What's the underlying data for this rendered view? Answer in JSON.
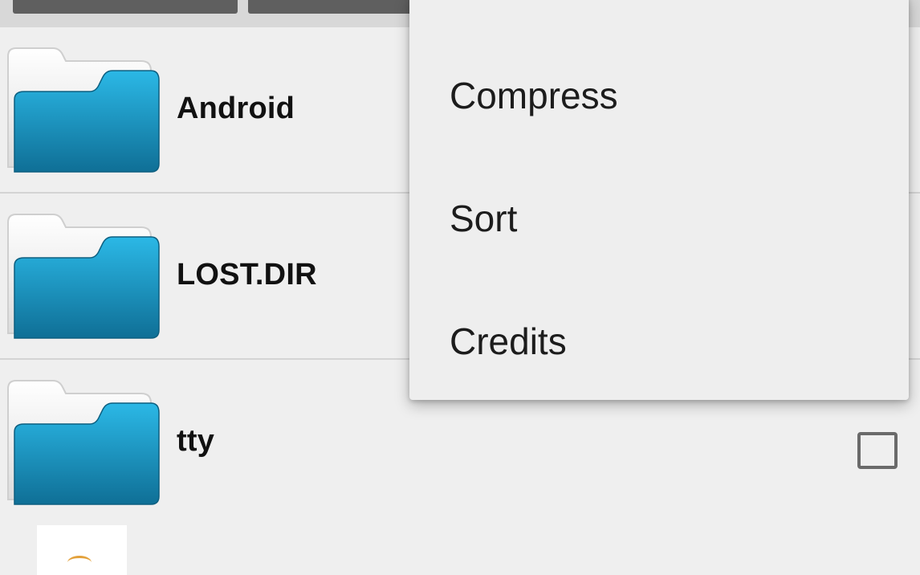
{
  "files": [
    {
      "name": "Android"
    },
    {
      "name": "LOST.DIR"
    },
    {
      "name": "tty"
    }
  ],
  "menu": {
    "items": [
      {
        "label": "Compress"
      },
      {
        "label": "Sort"
      },
      {
        "label": "Credits"
      }
    ]
  },
  "icons": {
    "folder": "folder-icon",
    "checkbox": "checkbox-unchecked"
  },
  "colors": {
    "folder_front": "#1b9ccf",
    "folder_back": "#f6f6f6",
    "background": "#efefef",
    "menu_background": "#eeeeee"
  }
}
